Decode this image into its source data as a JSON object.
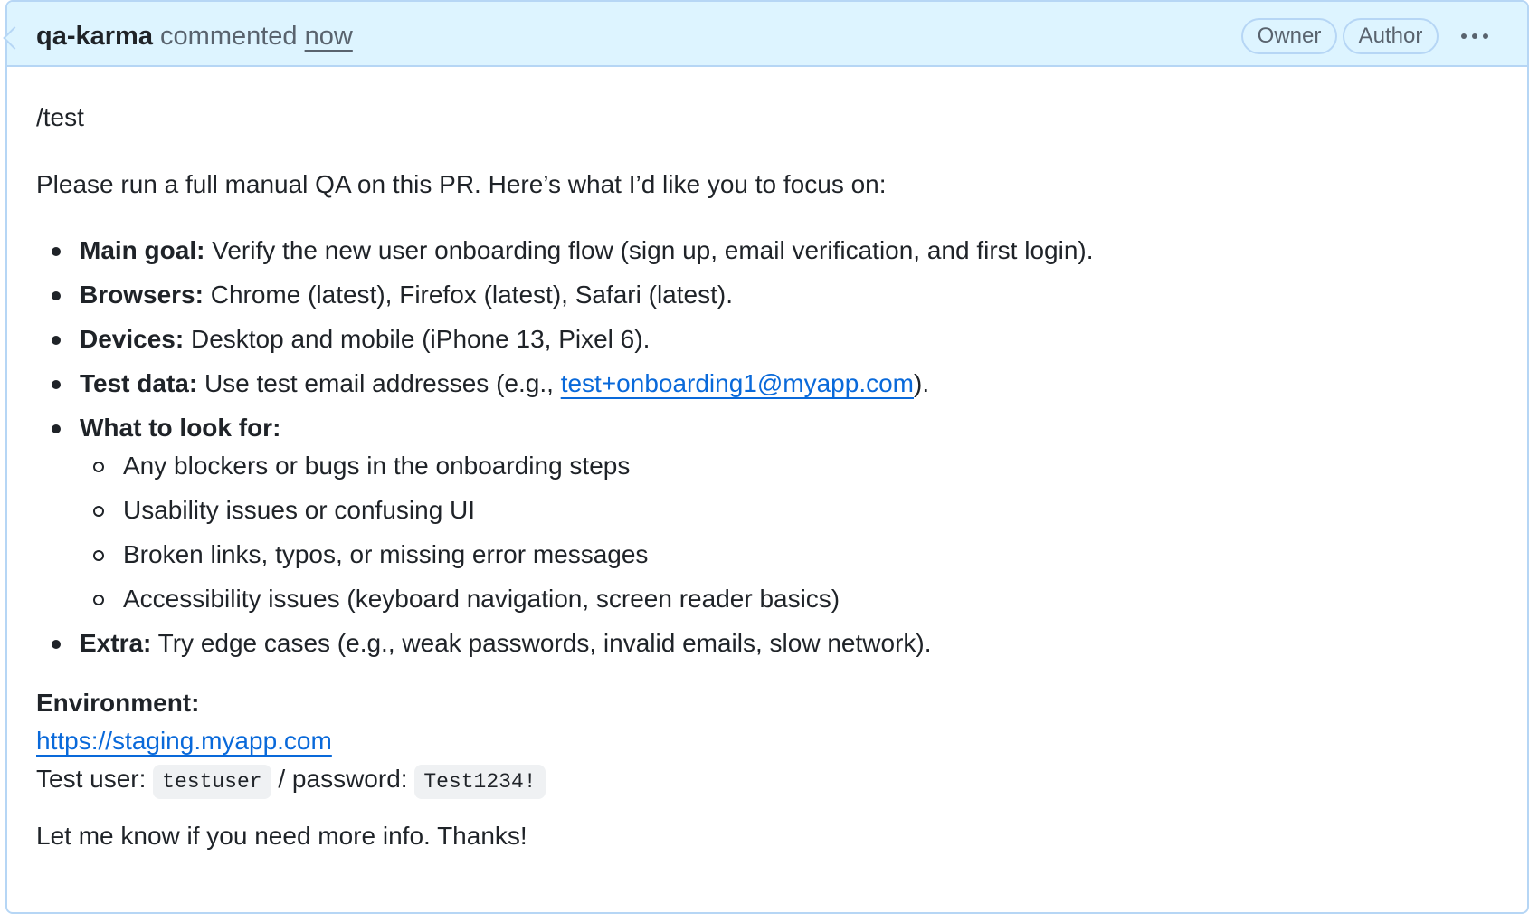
{
  "header": {
    "author": "qa-karma",
    "action": "commented",
    "timestamp": "now",
    "badges": [
      "Owner",
      "Author"
    ],
    "menu_icon": "kebab-horizontal-icon"
  },
  "body": {
    "command": "/test",
    "intro": "Please run a full manual QA on this PR. Here’s what I’d like you to focus on:",
    "items": [
      {
        "label": "Main goal:",
        "text": " Verify the new user onboarding flow (sign up, email verification, and first login)."
      },
      {
        "label": "Browsers:",
        "text": " Chrome (latest), Firefox (latest), Safari (latest)."
      },
      {
        "label": "Devices:",
        "text": " Desktop and mobile (iPhone 13, Pixel 6)."
      },
      {
        "label": "Test data:",
        "text_before": " Use test email addresses (e.g., ",
        "link": "test+onboarding1@myapp.com",
        "text_after": ")."
      },
      {
        "label": "What to look for:",
        "subitems": [
          "Any blockers or bugs in the onboarding steps",
          "Usability issues or confusing UI",
          "Broken links, typos, or missing error messages",
          "Accessibility issues (keyboard navigation, screen reader basics)"
        ]
      },
      {
        "label": "Extra:",
        "text": " Try edge cases (e.g., weak passwords, invalid emails, slow network)."
      }
    ],
    "environment": {
      "label": "Environment:",
      "url": "https://staging.myapp.com",
      "user_prefix": "Test user: ",
      "username": "testuser",
      "password_prefix": " / password: ",
      "password": "Test1234!"
    },
    "closing": "Let me know if you need more info. Thanks!"
  },
  "colors": {
    "header_bg": "#ddf4ff",
    "border": "#b6d6f5",
    "link": "#0969da",
    "muted": "#59636e",
    "text": "#1f2328",
    "code_bg": "#eff1f3"
  }
}
